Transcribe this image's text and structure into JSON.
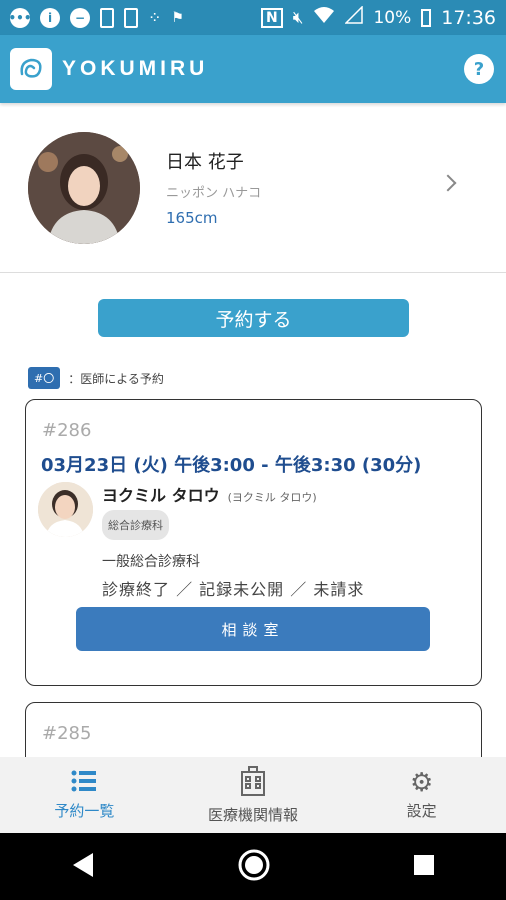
{
  "status_bar": {
    "battery": "10%",
    "time": "17:36"
  },
  "app": {
    "name": "YOKUMIRU",
    "help_label": "?"
  },
  "profile": {
    "name": "日本 花子",
    "kana": "ニッポン ハナコ",
    "height": "165cm"
  },
  "reserve_button": "予約する",
  "legend": {
    "tag": "#〇",
    "text": "：医師による予約"
  },
  "appointments": [
    {
      "id": "#286",
      "datetime": "03月23日 (火) 午後3:00 - 午後3:30 (30分)",
      "doctor_name": "ヨクミル タロウ",
      "doctor_kana": "(ヨクミル タロウ)",
      "department_tag": "総合診療科",
      "department": "一般総合診療科",
      "status": "診療終了 ／ 記録未公開 ／ 未請求",
      "room_button": "相談室"
    },
    {
      "id": "#285"
    }
  ],
  "bottom_nav": [
    {
      "label": "予約一覧",
      "icon": "list-icon",
      "active": true
    },
    {
      "label": "医療機関情報",
      "icon": "hospital-icon",
      "active": false
    },
    {
      "label": "設定",
      "icon": "gear-icon",
      "active": false
    }
  ],
  "colors": {
    "primary": "#3aa1cc",
    "accent": "#2f6eb0",
    "statusbar": "#2b8bb5"
  }
}
